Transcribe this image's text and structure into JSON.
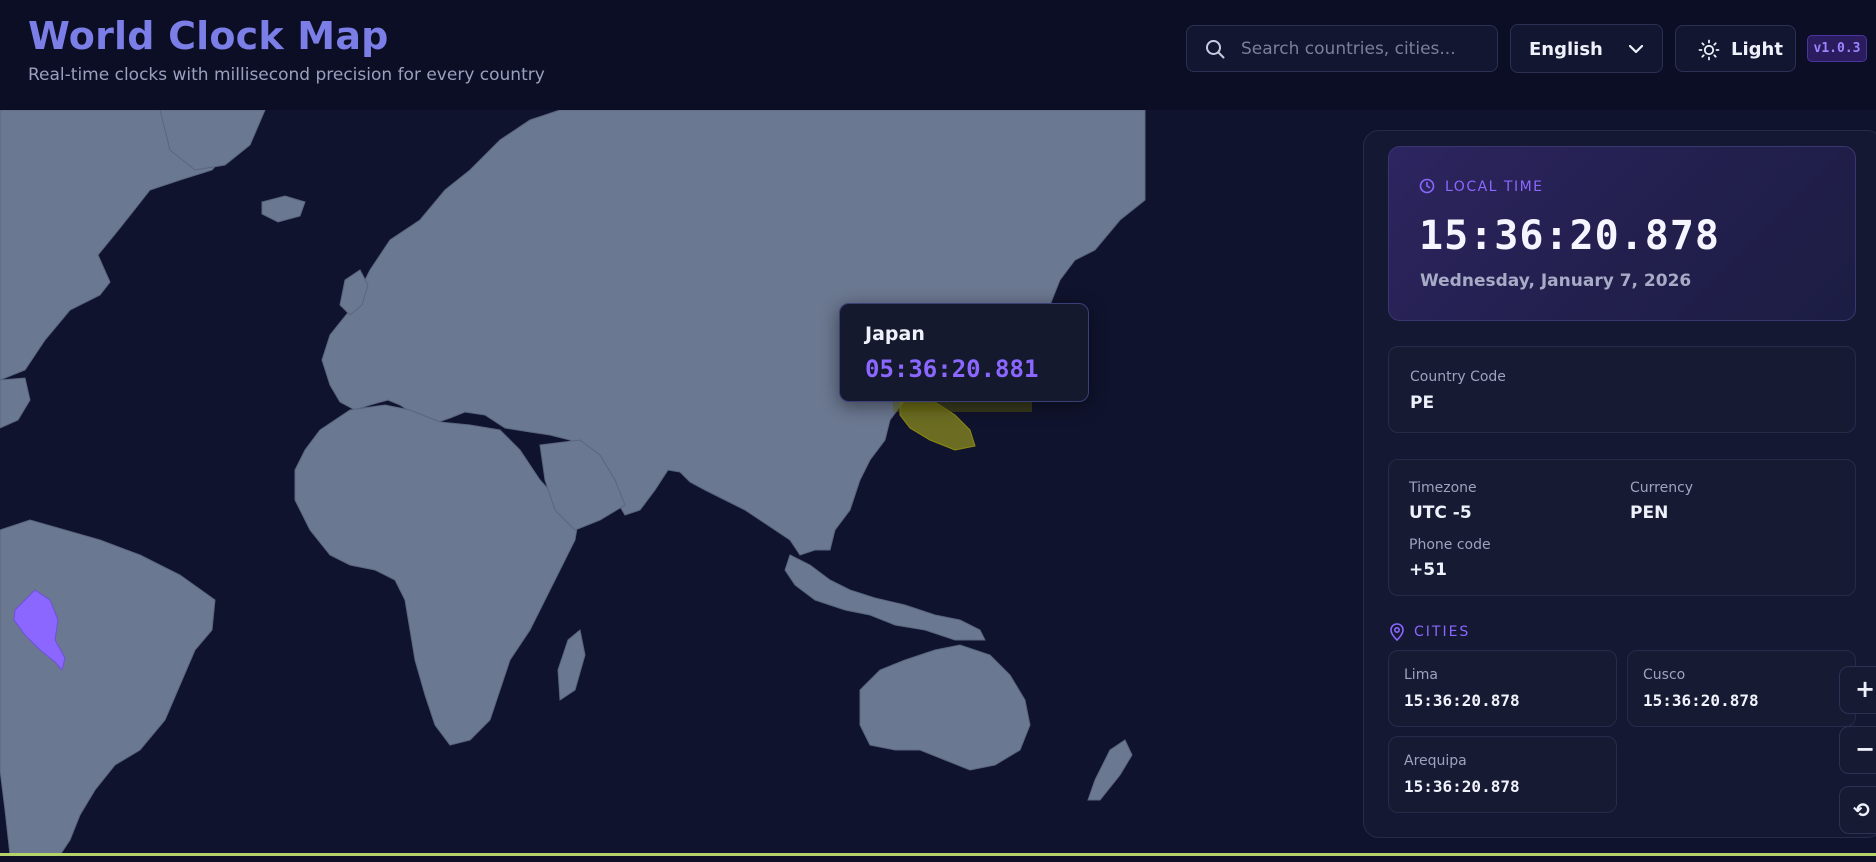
{
  "header": {
    "title": "World Clock Map",
    "subtitle": "Real-time clocks with millisecond precision for every country",
    "search_placeholder": "Search countries, cities...",
    "language": "English",
    "theme_label": "Light",
    "version": "v1.0.3"
  },
  "map": {
    "highlighted_country": "Peru",
    "hover_country": "Japan",
    "colors": {
      "land": "#6b7891",
      "ocean": "#10132d",
      "selected": "#8b67ff",
      "hover": "#b8b81a"
    }
  },
  "tooltip": {
    "country": "Japan",
    "time": "05:36:20.881"
  },
  "local_time": {
    "caption": "LOCAL TIME",
    "time": "15:36:20.878",
    "date": "Wednesday, January 7, 2026"
  },
  "country_code": {
    "label": "Country Code",
    "value": "PE"
  },
  "details": {
    "timezone_label": "Timezone",
    "timezone": "UTC -5",
    "currency_label": "Currency",
    "currency": "PEN",
    "phone_label": "Phone code",
    "phone": "+51"
  },
  "cities": {
    "caption": "CITIES",
    "items": [
      {
        "name": "Lima",
        "time": "15:36:20.878"
      },
      {
        "name": "Cusco",
        "time": "15:36:20.878"
      },
      {
        "name": "Arequipa",
        "time": "15:36:20.878"
      }
    ]
  },
  "zoom": {
    "in": "+",
    "out": "−",
    "reset": "⟲"
  },
  "icons": [
    "search-icon",
    "chevron-down-icon",
    "sun-icon",
    "clock-icon",
    "map-pin-icon",
    "reset-icon"
  ]
}
